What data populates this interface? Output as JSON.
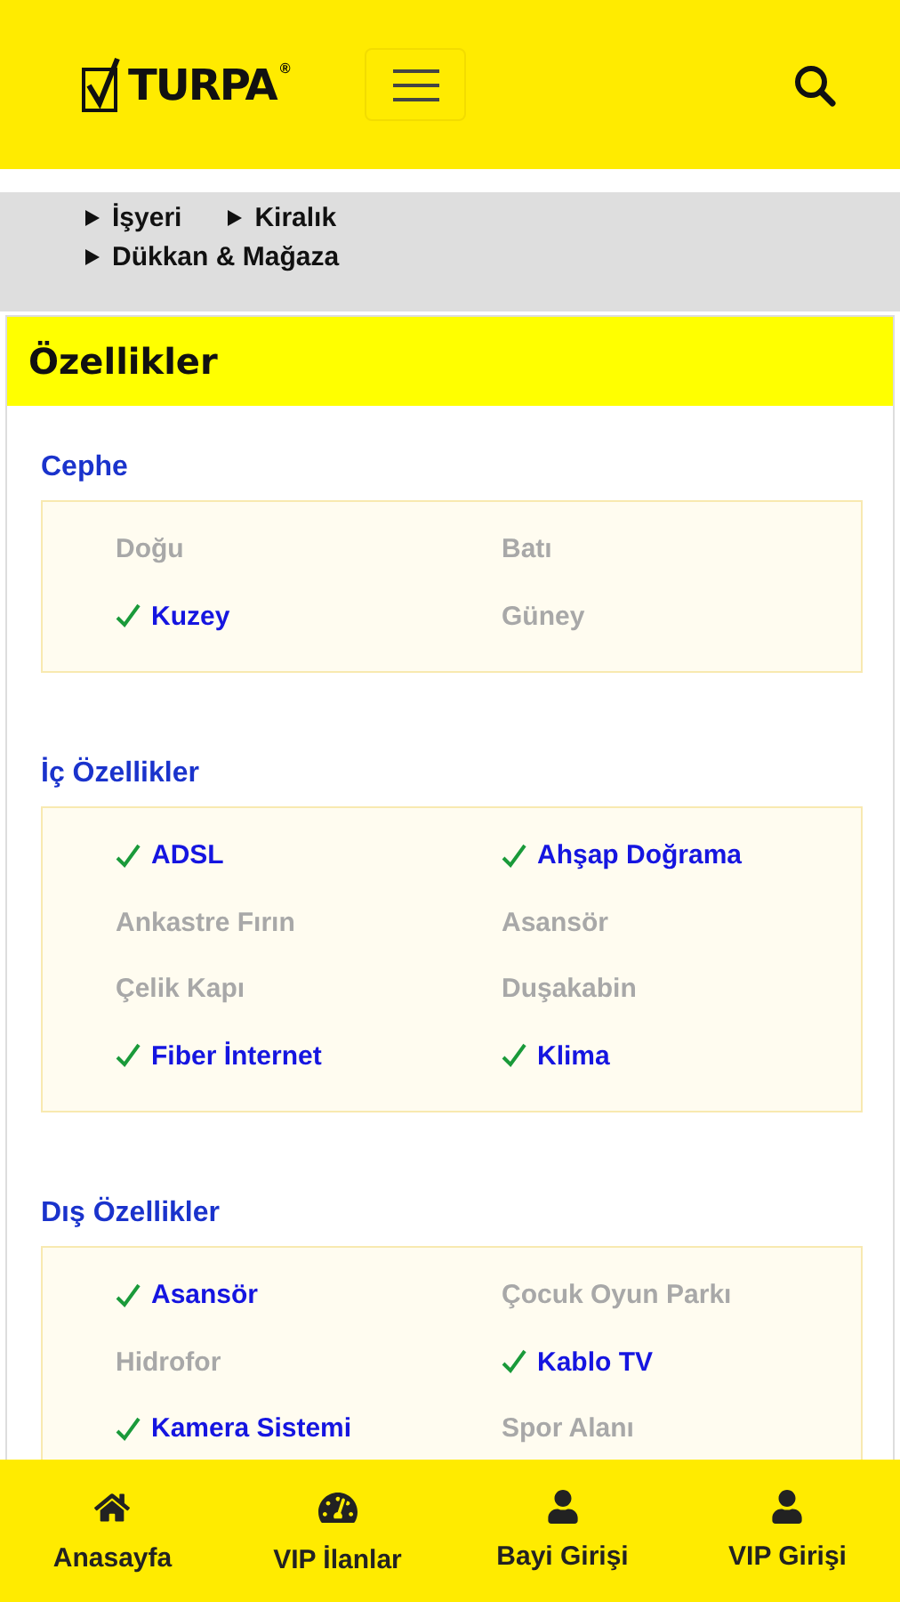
{
  "header": {
    "logo": {
      "text": "TURPA",
      "mark": "®"
    }
  },
  "breadcrumbs": [
    "İşyeri",
    "Kiralık",
    "Dükkan & Mağaza"
  ],
  "panel": {
    "title": "Özellikler",
    "sections": [
      {
        "title": "Cephe",
        "items": [
          {
            "label": "Doğu",
            "checked": false
          },
          {
            "label": "Batı",
            "checked": false
          },
          {
            "label": "Kuzey",
            "checked": true
          },
          {
            "label": "Güney",
            "checked": false
          }
        ]
      },
      {
        "title": "İç Özellikler",
        "items": [
          {
            "label": "ADSL",
            "checked": true
          },
          {
            "label": "Ahşap Doğrama",
            "checked": true
          },
          {
            "label": "Ankastre Fırın",
            "checked": false
          },
          {
            "label": "Asansör",
            "checked": false
          },
          {
            "label": "Çelik Kapı",
            "checked": false
          },
          {
            "label": "Duşakabin",
            "checked": false
          },
          {
            "label": "Fiber İnternet",
            "checked": true
          },
          {
            "label": "Klima",
            "checked": true
          }
        ]
      },
      {
        "title": "Dış Özellikler",
        "items": [
          {
            "label": "Asansör",
            "checked": true
          },
          {
            "label": "Çocuk Oyun Parkı",
            "checked": false
          },
          {
            "label": "Hidrofor",
            "checked": false
          },
          {
            "label": "Kablo TV",
            "checked": true
          },
          {
            "label": "Kamera Sistemi",
            "checked": true
          },
          {
            "label": "Spor Alanı",
            "checked": false
          }
        ]
      }
    ]
  },
  "bottom_nav": [
    {
      "label": "Anasayfa",
      "kind": "home"
    },
    {
      "label": "VIP İlanlar",
      "kind": "gauge"
    },
    {
      "label": "Bayi Girişi",
      "kind": "user"
    },
    {
      "label": "VIP Girişi",
      "kind": "user"
    }
  ]
}
